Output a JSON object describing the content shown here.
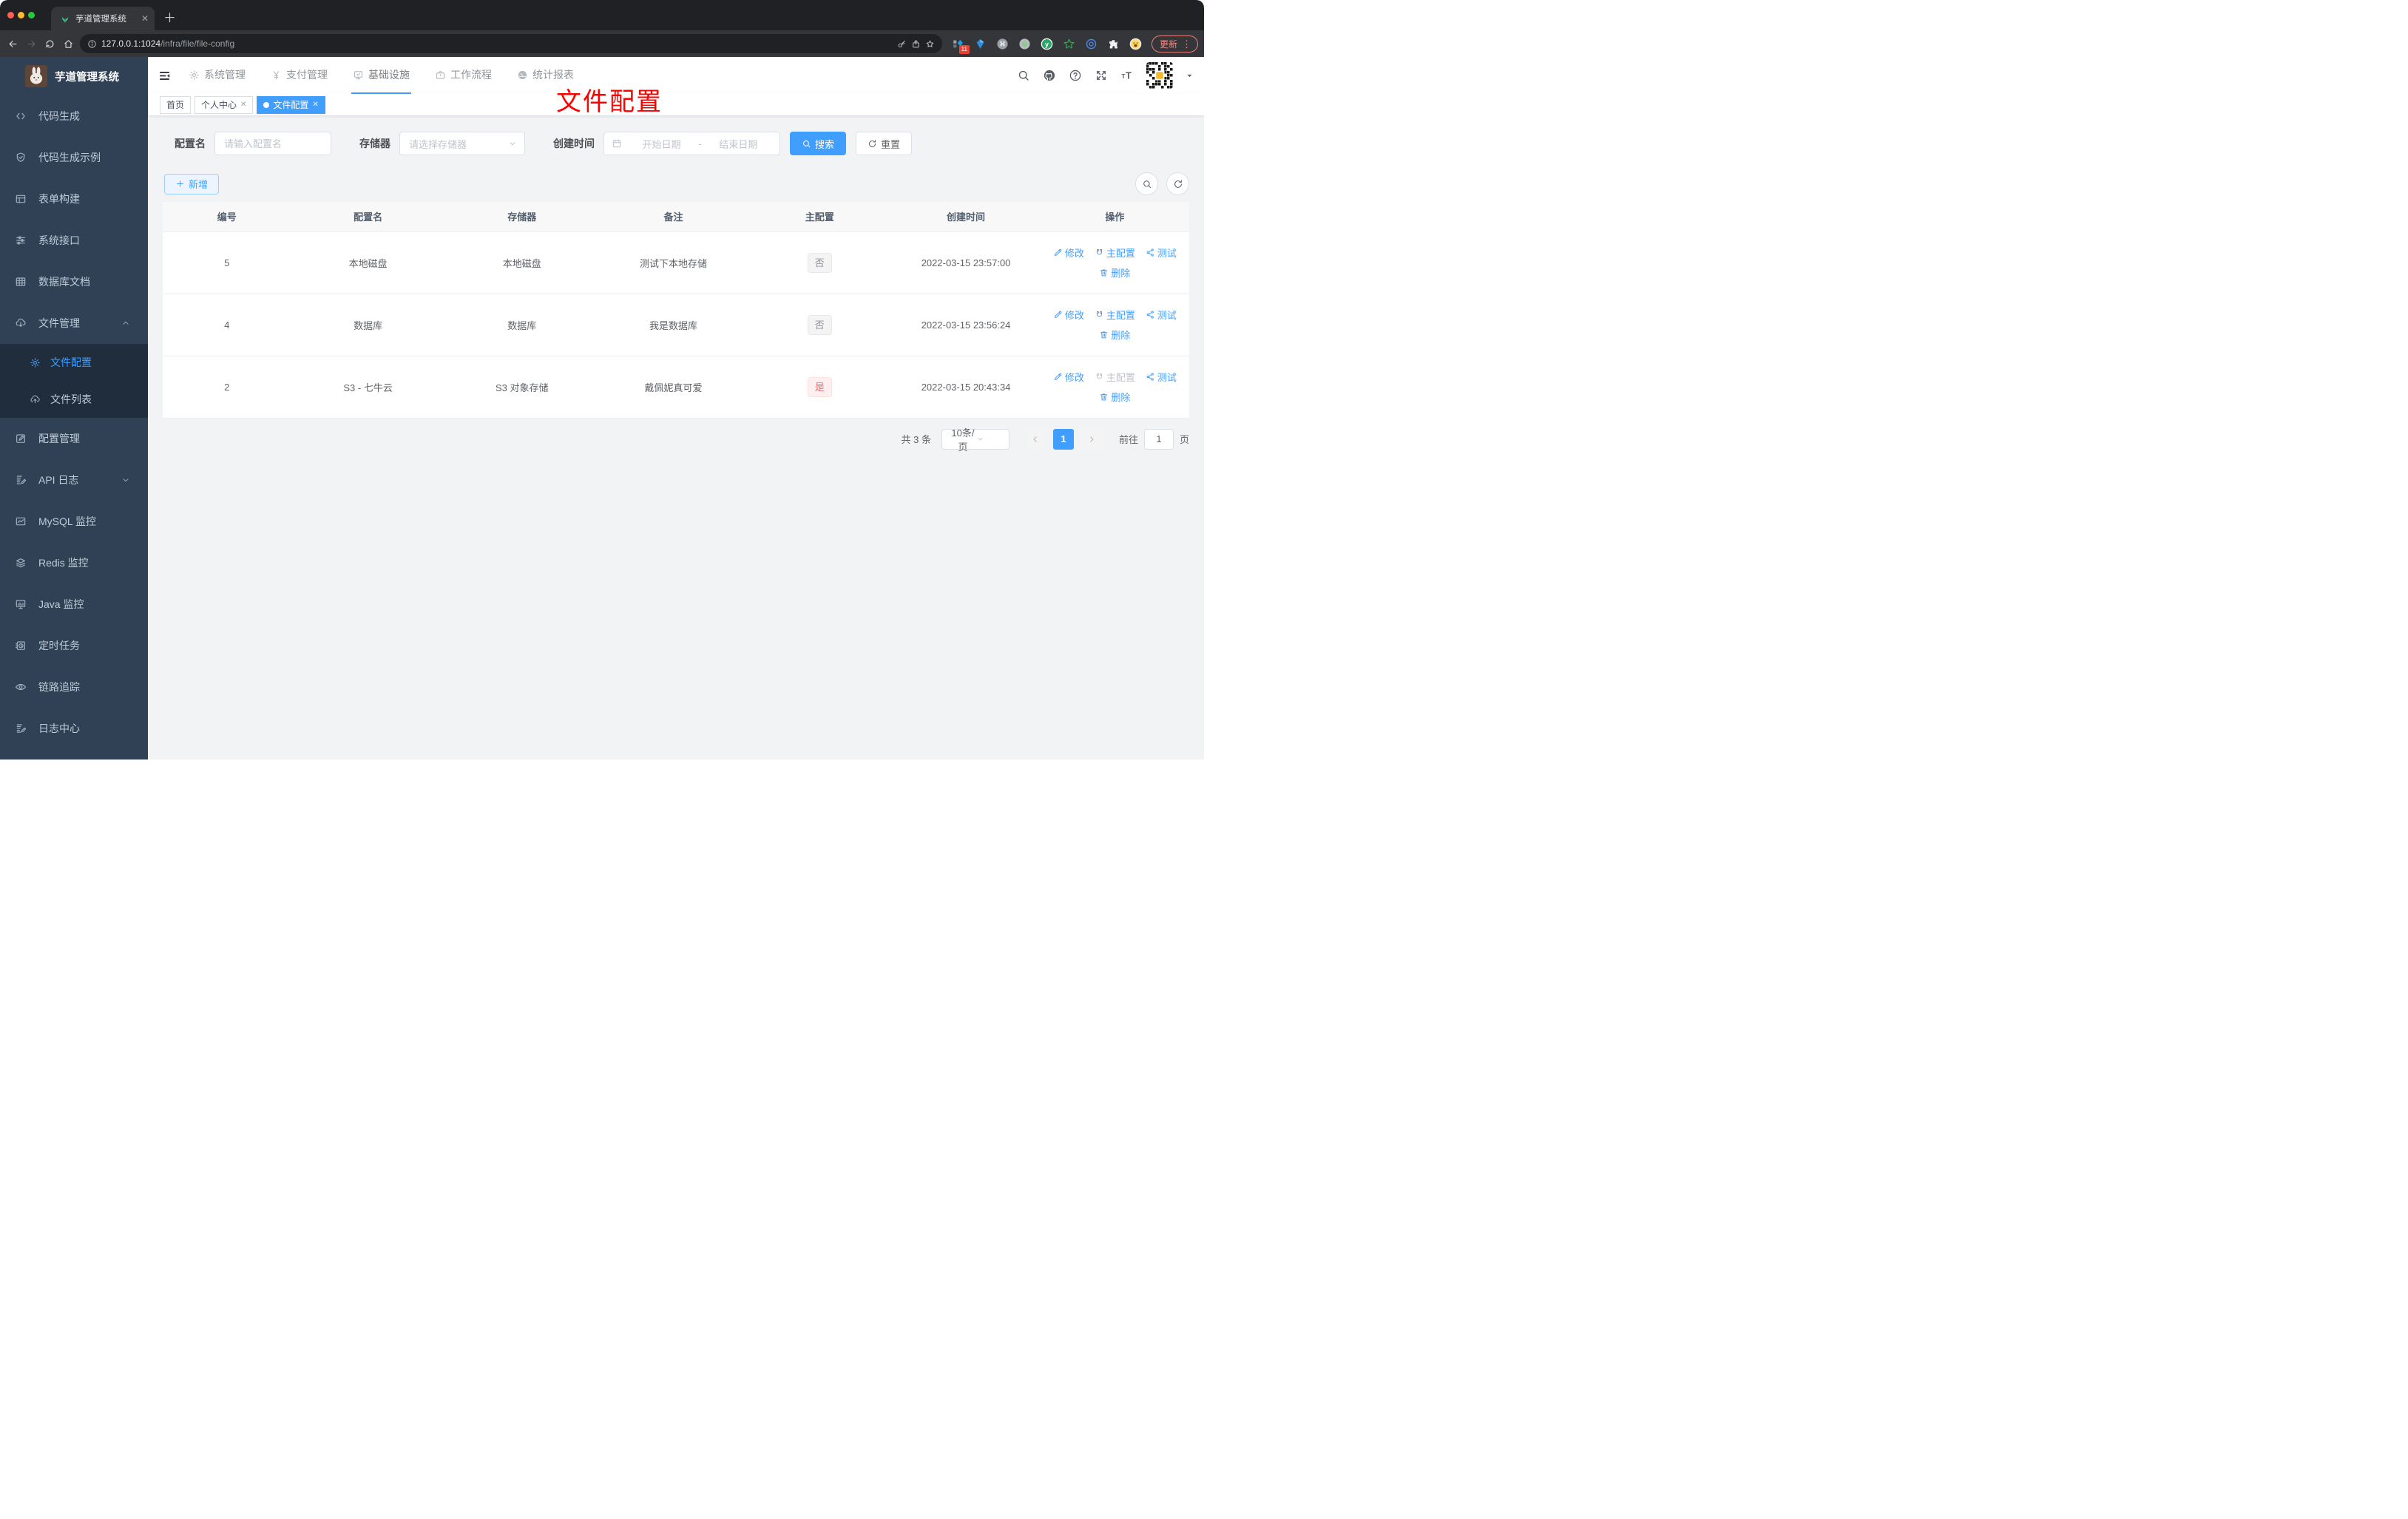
{
  "browser": {
    "tab_title": "芋道管理系统",
    "url_host": "127.0.0.1:1024",
    "url_path": "/infra/file/file-config",
    "update_label": "更新",
    "extensions": [
      {
        "icon": "squares-diamond",
        "badge": "11"
      },
      {
        "icon": "blue-gem"
      },
      {
        "icon": "command-circle"
      },
      {
        "icon": "gray-record"
      },
      {
        "icon": "green-y"
      },
      {
        "icon": "green-star"
      },
      {
        "icon": "blue-eye"
      },
      {
        "icon": "puzzle-piece"
      },
      {
        "icon": "emoji-face"
      }
    ]
  },
  "sidebar": {
    "title": "芋道管理系统",
    "items": [
      {
        "icon": "code",
        "label": "代码生成"
      },
      {
        "icon": "shield-check",
        "label": "代码生成示例"
      },
      {
        "icon": "form-table",
        "label": "表单构建"
      },
      {
        "icon": "sliders",
        "label": "系统接口"
      },
      {
        "icon": "grid",
        "label": "数据库文档"
      },
      {
        "icon": "cloud-down",
        "label": "文件管理",
        "arrow": "up",
        "children": [
          {
            "icon": "gear",
            "label": "文件配置",
            "active": true
          },
          {
            "icon": "cloud-up",
            "label": "文件列表"
          }
        ]
      },
      {
        "icon": "edit-square",
        "label": "配置管理"
      },
      {
        "icon": "note-edit",
        "label": "API 日志",
        "arrow": "down"
      },
      {
        "icon": "chart",
        "label": "MySQL 监控"
      },
      {
        "icon": "layers",
        "label": "Redis 监控"
      },
      {
        "icon": "monitor",
        "label": "Java 监控"
      },
      {
        "icon": "timer",
        "label": "定时任务"
      },
      {
        "icon": "eye",
        "label": "链路追踪"
      },
      {
        "icon": "note-edit",
        "label": "日志中心"
      }
    ]
  },
  "topnav": {
    "items": [
      {
        "icon": "gear",
        "label": "系统管理"
      },
      {
        "icon": "yen",
        "label": "支付管理"
      },
      {
        "icon": "monitor-check",
        "label": "基础设施",
        "active": true
      },
      {
        "icon": "briefcase",
        "label": "工作流程"
      },
      {
        "icon": "dashboard",
        "label": "统计报表"
      }
    ],
    "right_icons": [
      "search",
      "github",
      "question",
      "fullscreen",
      "font-size"
    ]
  },
  "tabs": [
    {
      "label": "首页"
    },
    {
      "label": "个人中心",
      "closable": true
    },
    {
      "label": "文件配置",
      "closable": true,
      "active": true
    }
  ],
  "annotation": "文件配置",
  "filters": {
    "name_label": "配置名",
    "name_placeholder": "请输入配置名",
    "storage_label": "存储器",
    "storage_placeholder": "请选择存储器",
    "date_label": "创建时间",
    "date_start": "开始日期",
    "date_separator": "-",
    "date_end": "结束日期",
    "search_label": "搜索",
    "reset_label": "重置"
  },
  "toolbar": {
    "add_label": "新增"
  },
  "table": {
    "columns": [
      "编号",
      "配置名",
      "存储器",
      "备注",
      "主配置",
      "创建时间",
      "操作"
    ],
    "rows": [
      {
        "id": "5",
        "name": "本地磁盘",
        "storage": "本地磁盘",
        "remark": "测试下本地存储",
        "master": {
          "label": "否",
          "type": "info"
        },
        "created": "2022-03-15 23:57:00",
        "actions": [
          {
            "label": "修改",
            "icon": "pencil"
          },
          {
            "label": "主配置",
            "icon": "magnet"
          },
          {
            "label": "测试",
            "icon": "share"
          },
          {
            "label": "删除",
            "icon": "trash",
            "line": 2
          }
        ]
      },
      {
        "id": "4",
        "name": "数据库",
        "storage": "数据库",
        "remark": "我是数据库",
        "master": {
          "label": "否",
          "type": "info"
        },
        "created": "2022-03-15 23:56:24",
        "actions": [
          {
            "label": "修改",
            "icon": "pencil"
          },
          {
            "label": "主配置",
            "icon": "magnet"
          },
          {
            "label": "测试",
            "icon": "share"
          },
          {
            "label": "删除",
            "icon": "trash",
            "line": 2
          }
        ]
      },
      {
        "id": "2",
        "name": "S3 - 七牛云",
        "storage": "S3 对象存储",
        "remark": "戴佩妮真可爱",
        "master": {
          "label": "是",
          "type": "danger"
        },
        "created": "2022-03-15 20:43:34",
        "actions": [
          {
            "label": "修改",
            "icon": "pencil"
          },
          {
            "label": "主配置",
            "icon": "magnet",
            "disabled": true
          },
          {
            "label": "测试",
            "icon": "share"
          },
          {
            "label": "删除",
            "icon": "trash",
            "line": 2
          }
        ]
      }
    ]
  },
  "pagination": {
    "total": "共 3 条",
    "page_size": "10条/页",
    "current_page": "1",
    "goto_label": "前往",
    "goto_value": "1",
    "unit_label": "页"
  },
  "colors": {
    "accent": "#409eff",
    "sidebar_bg": "#304156",
    "submenu_bg": "#1f2d3d",
    "danger": "#f56c6c",
    "annotation": "#fe0000"
  }
}
